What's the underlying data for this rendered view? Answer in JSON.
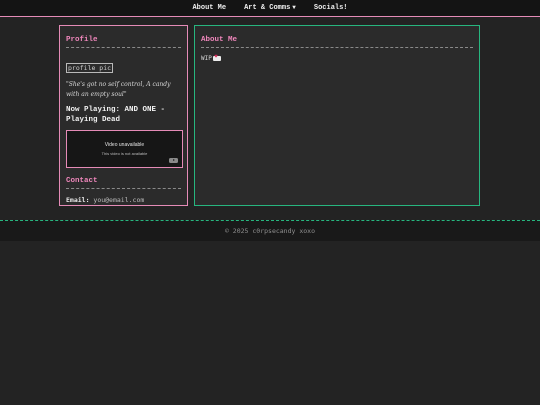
{
  "nav": {
    "items": [
      "About Me",
      "Art & Comms",
      "Socials!"
    ],
    "dropdown_caret": "▼"
  },
  "sidebar": {
    "profile_title": "Profile",
    "profile_pic_alt": "profile pic",
    "quote": "\"She's got no self control, A candy with an empty soul\"",
    "now_playing": "Now Playing: AND ONE - Playing Dead",
    "video": {
      "title": "Video unavailable",
      "subtitle": "This video is not available"
    },
    "contact_title": "Contact",
    "contact_label": "Email:",
    "contact_value": "you@email.com"
  },
  "main": {
    "title": "About Me",
    "wip_text": "WIP"
  },
  "footer": {
    "text": "© 2025 c0rpsecandy xoxo"
  },
  "colors": {
    "accent_pink": "#e58bb7",
    "accent_green": "#27b67f",
    "background": "#232323"
  }
}
